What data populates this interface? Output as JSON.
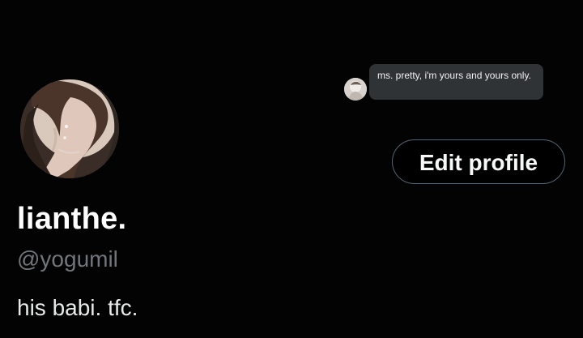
{
  "profile": {
    "display_name": "lianthe.",
    "handle": "@yogumil",
    "bio": "his babi. tfc.",
    "edit_button": "Edit profile",
    "reply_bubble": {
      "text": "ms. pretty, i'm yours and yours only."
    },
    "avatar_icon": "profile-photo",
    "bubble_avatar_icon": "reply-avatar"
  },
  "colors": {
    "background": "#000000",
    "primary_text": "#ffffff",
    "secondary_text": "#71767b",
    "bubble_background": "#2f3336",
    "button_border": "#536471"
  }
}
